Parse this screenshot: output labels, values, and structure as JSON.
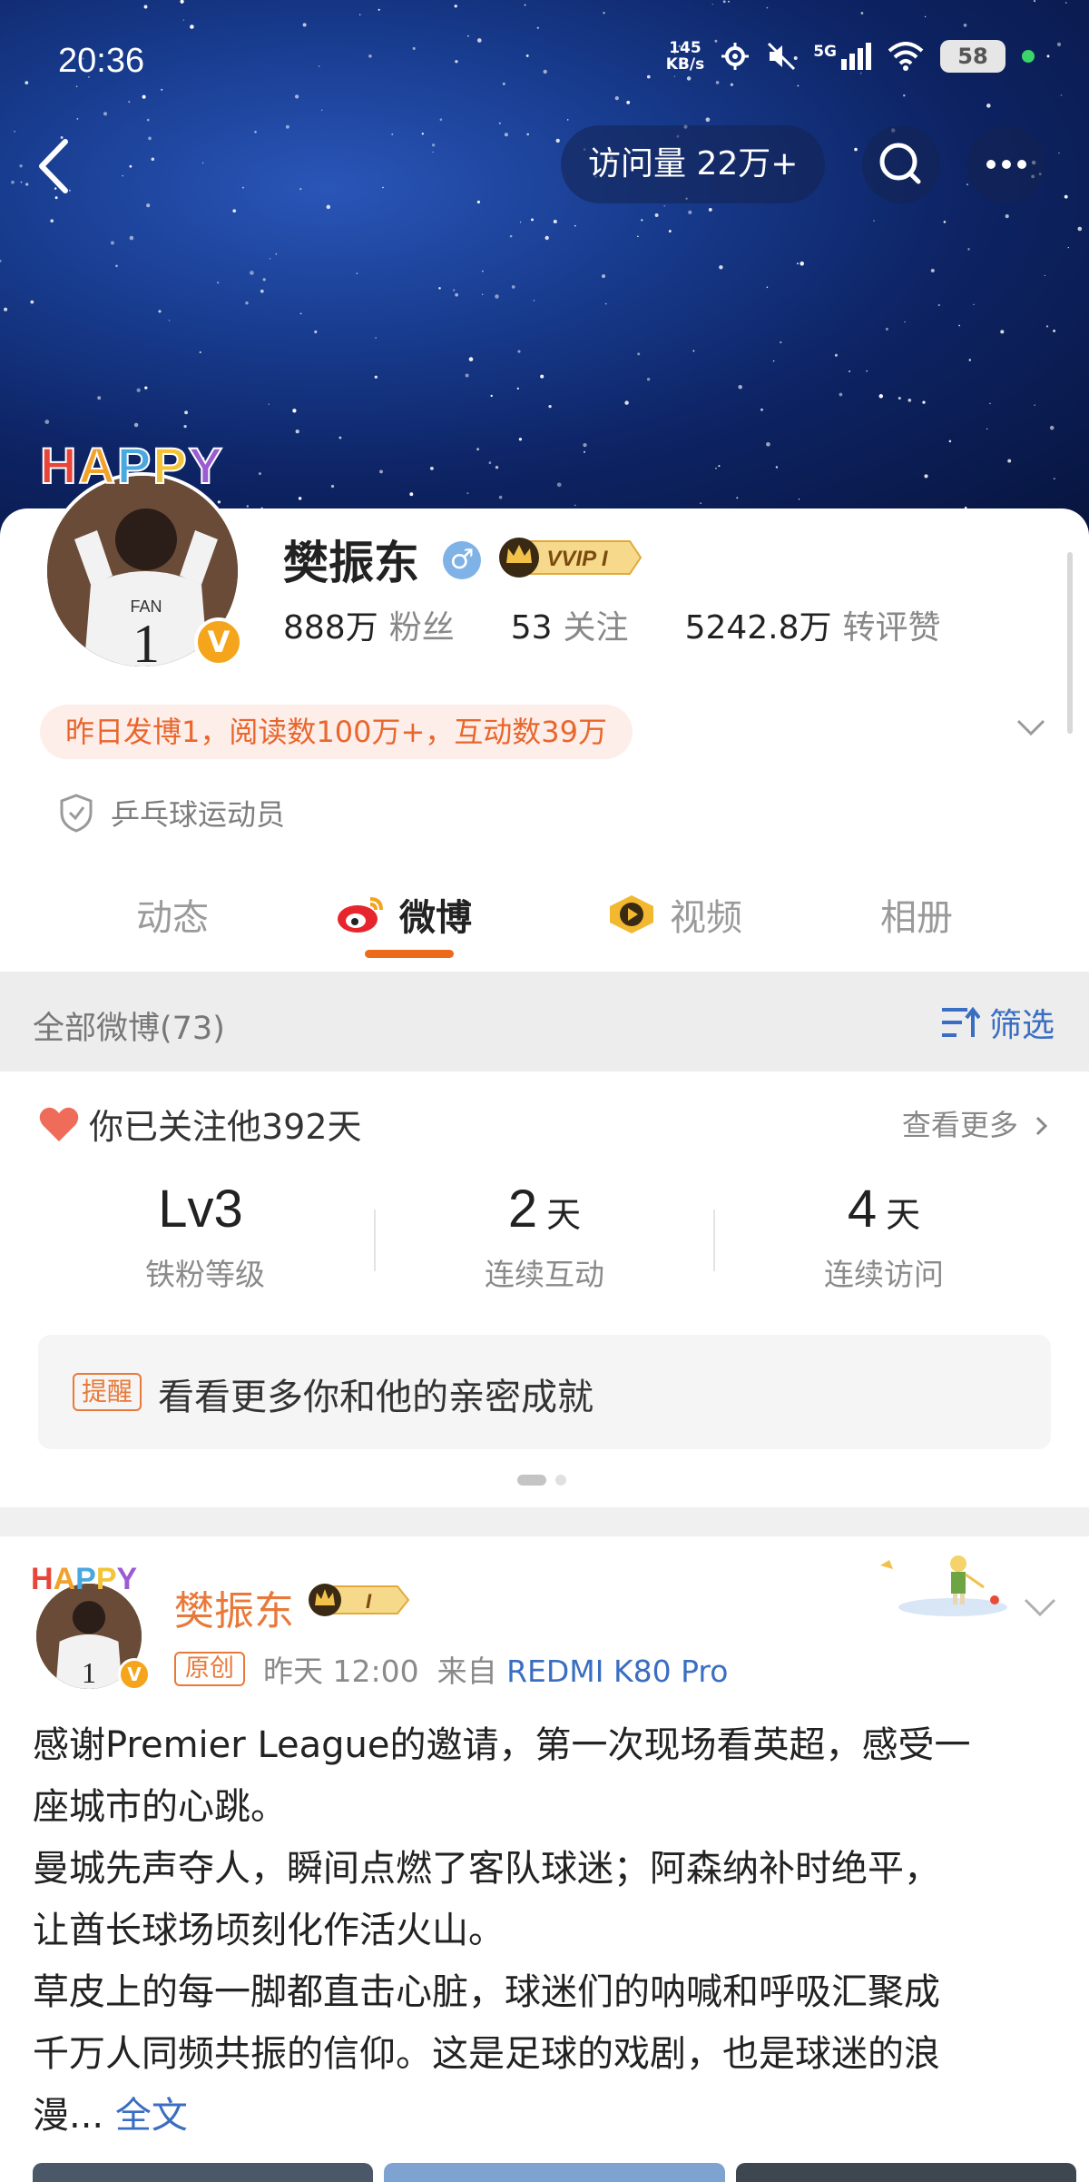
{
  "status_bar": {
    "time": "20:36",
    "net_speed_value": "145",
    "net_speed_unit": "KB/s",
    "signal_label": "5G",
    "battery": "58"
  },
  "nav": {
    "visit_label": "访问量 22万+"
  },
  "profile": {
    "happy_text": "HAPPY",
    "name": "樊振东",
    "gender_symbol": "♂",
    "vip_label": "VVIP I",
    "verified_badge": "V",
    "stats": [
      {
        "value": "888万",
        "label": "粉丝"
      },
      {
        "value": "53",
        "label": "关注"
      },
      {
        "value": "5242.8万",
        "label": "转评赞"
      }
    ],
    "daily_summary": "昨日发博1，阅读数100万+，互动数39万",
    "verification": "乒乓球运动员"
  },
  "tabs": [
    {
      "label": "动态",
      "active": false,
      "icon": null
    },
    {
      "label": "微博",
      "active": true,
      "icon": "weibo-icon"
    },
    {
      "label": "视频",
      "active": false,
      "icon": "video-icon"
    },
    {
      "label": "相册",
      "active": false,
      "icon": null
    }
  ],
  "filter": {
    "title": "全部微博(73)",
    "button": "筛选"
  },
  "follow": {
    "text": "你已关注他392天",
    "see_more": "查看更多",
    "metrics": [
      {
        "value": "Lv3",
        "unit": "",
        "caption": "铁粉等级"
      },
      {
        "value": "2",
        "unit": "天",
        "caption": "连续互动"
      },
      {
        "value": "4",
        "unit": "天",
        "caption": "连续访问"
      }
    ],
    "reminder_tag": "提醒",
    "reminder_text": "看看更多你和他的亲密成就"
  },
  "post": {
    "author": "樊振东",
    "badge": "I",
    "original_tag": "原创",
    "time": "昨天 12:00",
    "source_prefix": "来自",
    "source": "REDMI K80 Pro",
    "lines": [
      "感谢Premier League的邀请，第一次现场看英超，感受一",
      "座城市的心跳。",
      "曼城先声夺人，瞬间点燃了客队球迷；阿森纳补时绝平，",
      "让酋长球场顷刻化作活火山。",
      "草皮上的每一脚都直击心脏，球迷们的呐喊和呼吸汇聚成",
      "千万人同频共振的信仰。这是足球的戏剧，也是球迷的浪",
      "漫..."
    ],
    "full_text_link": "全文"
  },
  "colors": {
    "accent": "#ec6a1c",
    "link": "#3a6ec2",
    "orange_text": "#e9662d"
  }
}
